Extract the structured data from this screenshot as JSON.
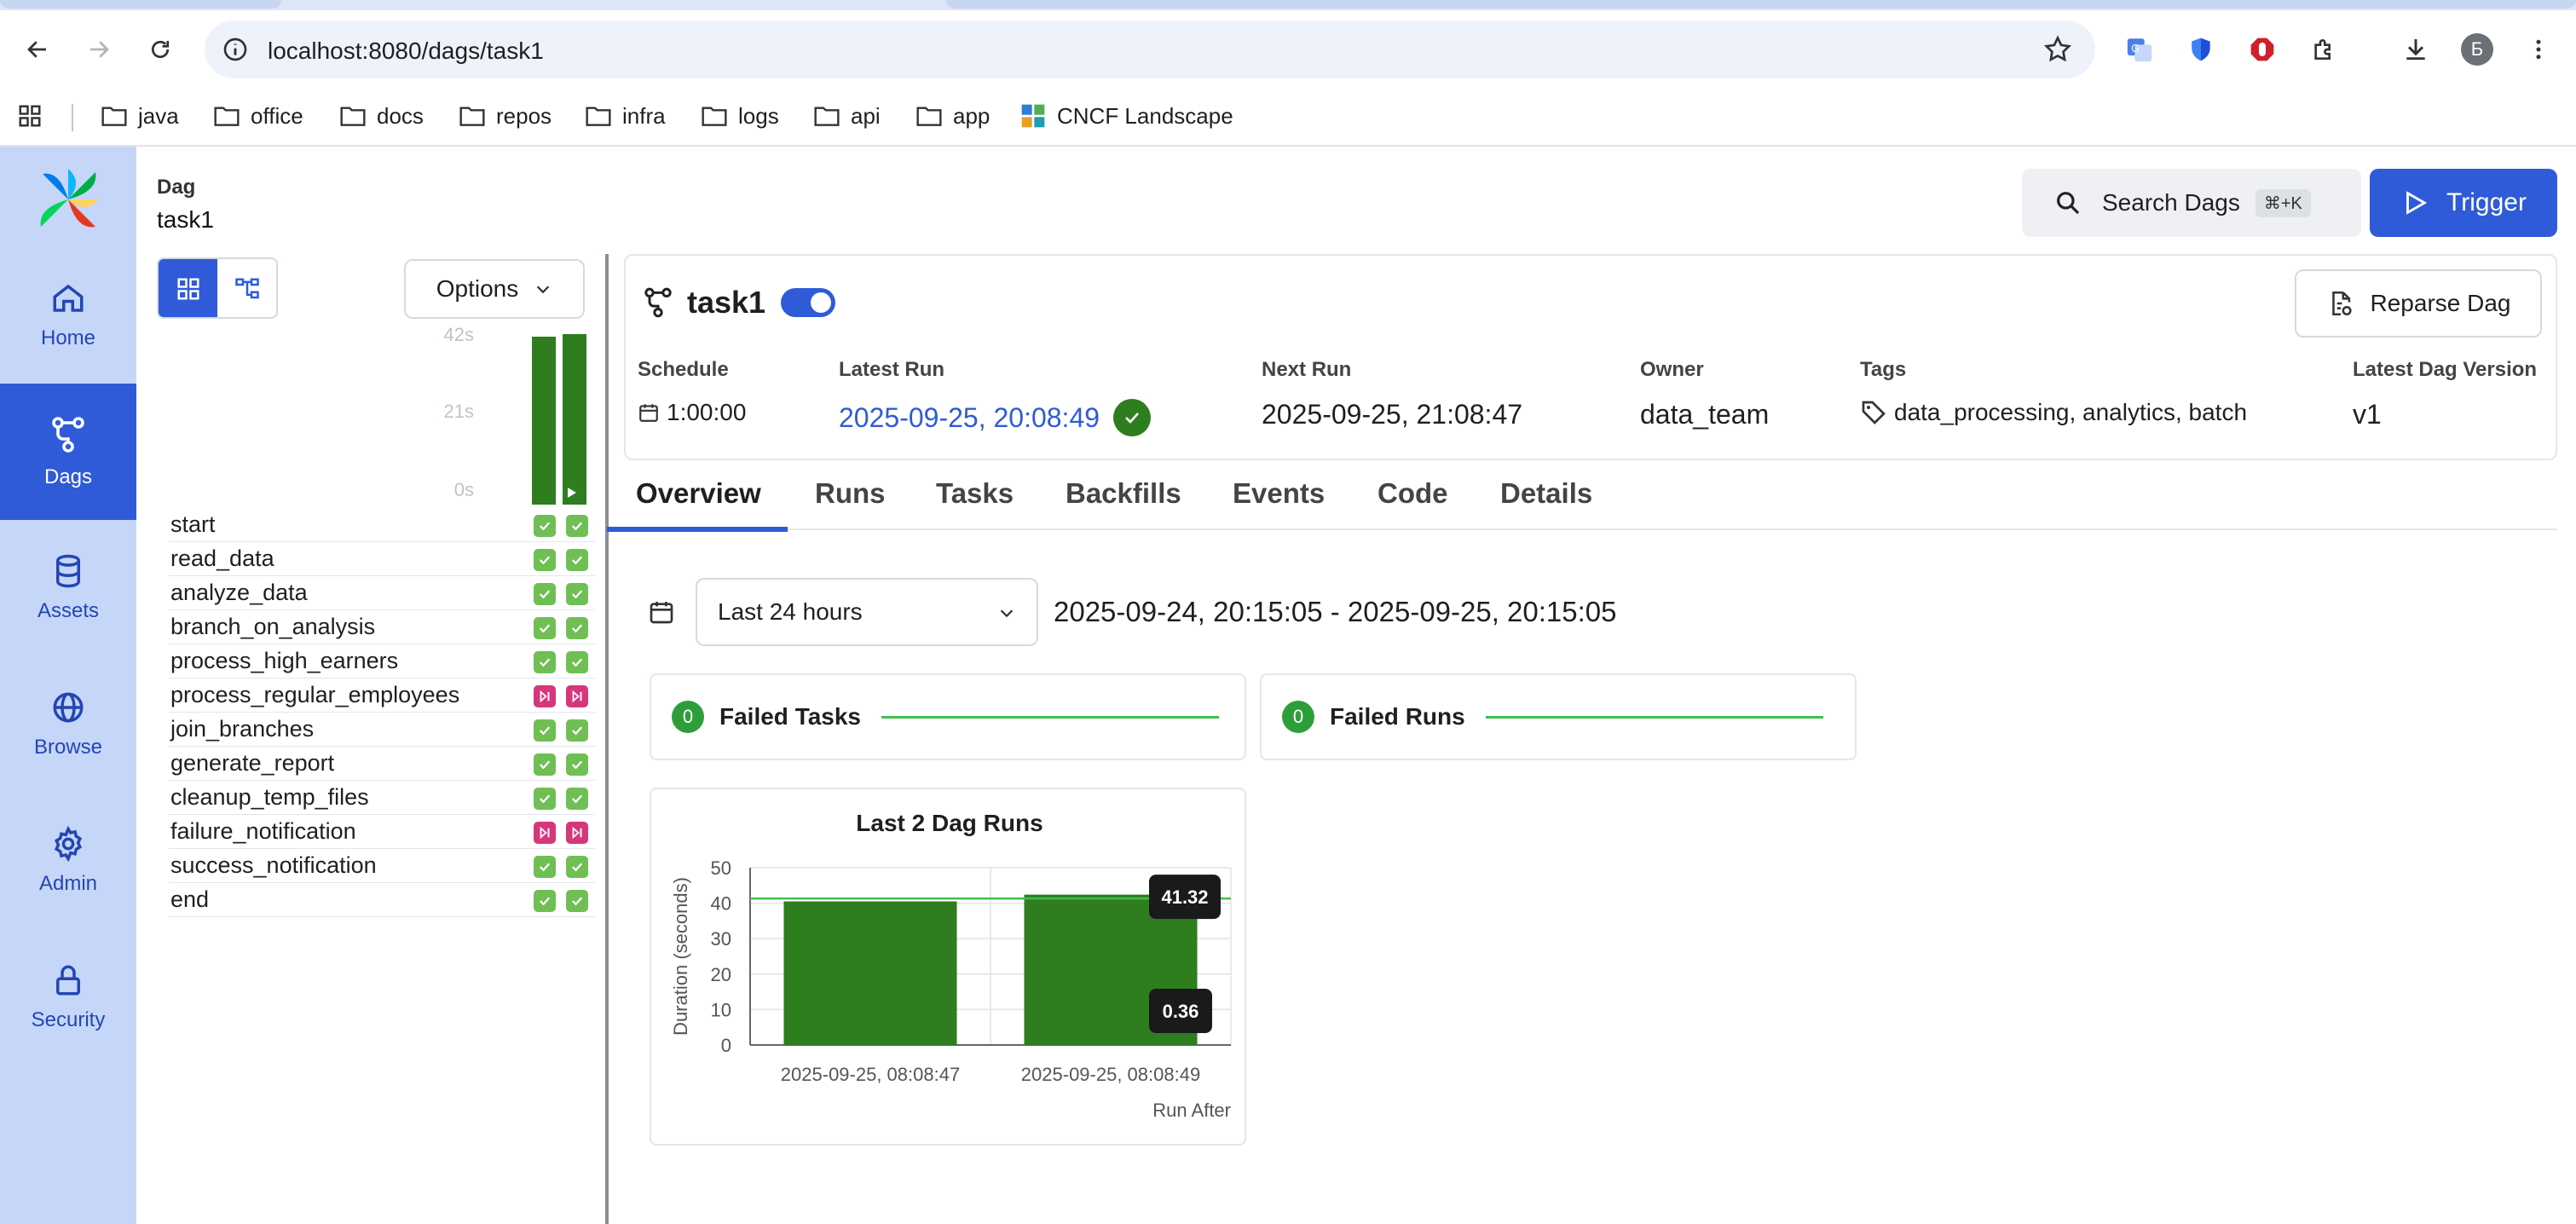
{
  "browser": {
    "url": "localhost:8080/dags/task1",
    "profile_initial": "Б",
    "bookmarks": [
      "java",
      "office",
      "docs",
      "repos",
      "infra",
      "logs",
      "api",
      "app",
      "CNCF Landscape"
    ]
  },
  "sidebar": {
    "items": [
      {
        "label": "Home",
        "icon": "home-icon"
      },
      {
        "label": "Dags",
        "icon": "dags-icon",
        "active": true
      },
      {
        "label": "Assets",
        "icon": "database-icon"
      },
      {
        "label": "Browse",
        "icon": "globe-icon"
      },
      {
        "label": "Admin",
        "icon": "gear-icon"
      },
      {
        "label": "Security",
        "icon": "lock-icon"
      }
    ]
  },
  "left_panel": {
    "dag_label": "Dag",
    "dag_name": "task1",
    "options_label": "Options",
    "duration_ticks": [
      "42s",
      "21s",
      "0s"
    ],
    "runs": [
      {
        "duration": 41.32
      },
      {
        "duration": 42.0
      }
    ],
    "tasks": [
      {
        "name": "start",
        "states": [
          "success",
          "success"
        ]
      },
      {
        "name": "read_data",
        "states": [
          "success",
          "success"
        ]
      },
      {
        "name": "analyze_data",
        "states": [
          "success",
          "success"
        ]
      },
      {
        "name": "branch_on_analysis",
        "states": [
          "success",
          "success"
        ]
      },
      {
        "name": "process_high_earners",
        "states": [
          "success",
          "success"
        ]
      },
      {
        "name": "process_regular_employees",
        "states": [
          "skipped",
          "skipped"
        ]
      },
      {
        "name": "join_branches",
        "states": [
          "success",
          "success"
        ]
      },
      {
        "name": "generate_report",
        "states": [
          "success",
          "success"
        ]
      },
      {
        "name": "cleanup_temp_files",
        "states": [
          "success",
          "success"
        ]
      },
      {
        "name": "failure_notification",
        "states": [
          "skipped",
          "skipped"
        ]
      },
      {
        "name": "success_notification",
        "states": [
          "success",
          "success"
        ]
      },
      {
        "name": "end",
        "states": [
          "success",
          "success"
        ]
      }
    ]
  },
  "topbar": {
    "search_label": "Search Dags",
    "search_shortcut": "⌘+K",
    "trigger_label": "Trigger"
  },
  "header": {
    "title": "task1",
    "reparse_label": "Reparse Dag",
    "schedule_label": "Schedule",
    "schedule_value": "1:00:00",
    "latest_run_label": "Latest Run",
    "latest_run_value": "2025-09-25, 20:08:49",
    "next_run_label": "Next Run",
    "next_run_value": "2025-09-25, 21:08:47",
    "owner_label": "Owner",
    "owner_value": "data_team",
    "tags_label": "Tags",
    "tags_value": "data_processing, analytics, batch",
    "version_label": "Latest Dag Version",
    "version_value": "v1"
  },
  "tabs": [
    "Overview",
    "Runs",
    "Tasks",
    "Backfills",
    "Events",
    "Code",
    "Details"
  ],
  "overview": {
    "range_select": "Last 24 hours",
    "range_text": "2025-09-24, 20:15:05 - 2025-09-25, 20:15:05",
    "failed_tasks": {
      "count": "0",
      "label": "Failed Tasks"
    },
    "failed_runs": {
      "count": "0",
      "label": "Failed Runs"
    }
  },
  "colors": {
    "accent": "#2f5bd8",
    "sidebar_bg": "#c5d6f8",
    "success": "#6fbf54",
    "skipped": "#d6367a",
    "bar": "#2e7d1f"
  },
  "chart_data": {
    "type": "bar",
    "title": "Last 2 Dag Runs",
    "xlabel": "Run After",
    "ylabel": "Duration (seconds)",
    "ylim": [
      0,
      50
    ],
    "yticks": [
      0,
      10,
      20,
      30,
      40,
      50
    ],
    "categories": [
      "2025-09-25, 08:08:47",
      "2025-09-25, 08:08:49"
    ],
    "series": [
      {
        "values": [
          40.5,
          42.4
        ]
      }
    ],
    "reference_line": 41.32,
    "annotations": [
      {
        "label": "41.32"
      },
      {
        "label": "0.36"
      }
    ],
    "grid": true
  }
}
